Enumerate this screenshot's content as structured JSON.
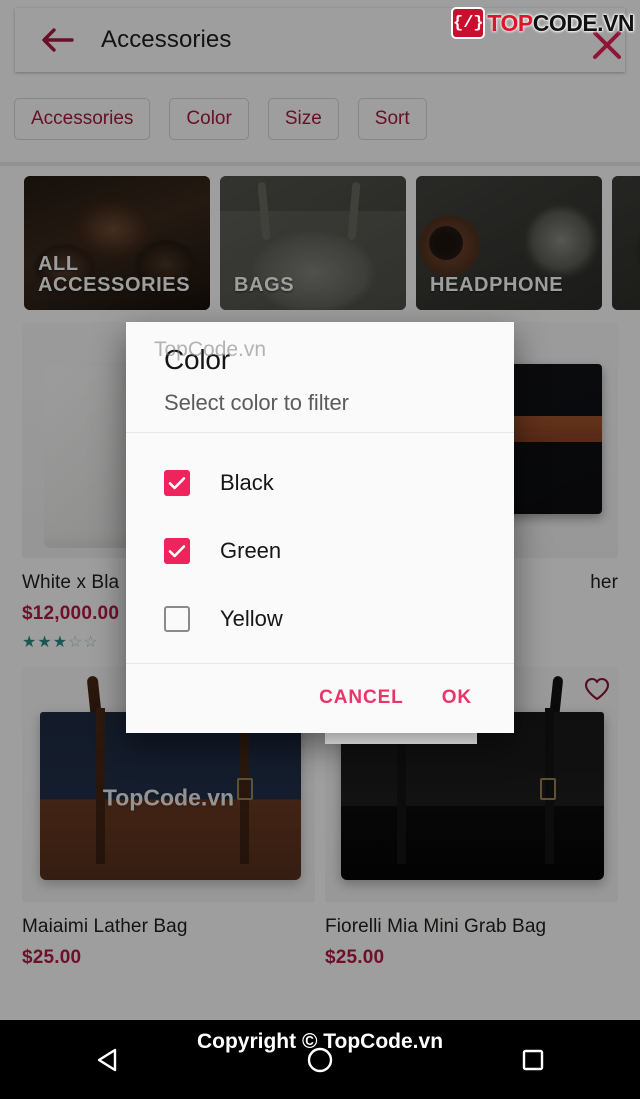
{
  "header": {
    "title": "Accessories",
    "back_icon": "back-arrow-icon",
    "close_icon": "close-x-icon"
  },
  "logo": {
    "badge": "{/}",
    "top": "TOP",
    "rest": "CODE.VN"
  },
  "filters": {
    "chips": [
      {
        "label": "Accessories"
      },
      {
        "label": "Color"
      },
      {
        "label": "Size"
      },
      {
        "label": "Sort"
      }
    ]
  },
  "categories": [
    {
      "label": "ALL\nACCESSORIES",
      "line1": "ALL",
      "line2": "ACCESSORIES"
    },
    {
      "label": "BAGS",
      "line1": "BAGS",
      "line2": ""
    },
    {
      "label": "HEADPHONE",
      "line1": "HEADPHONE",
      "line2": ""
    },
    {
      "label": "",
      "line1": "",
      "line2": ""
    }
  ],
  "products": {
    "row1": [
      {
        "name": "White x Bla",
        "price": "$12,000.00",
        "rating_filled": 3,
        "rating_total": 5,
        "stars_filled": "★★★",
        "stars_empty": "☆☆"
      },
      {
        "name": "her",
        "price": "",
        "rating_filled": 0,
        "rating_total": 5,
        "stars_filled": "",
        "stars_empty": ""
      }
    ],
    "row2": [
      {
        "name": "Maiaimi Lather Bag",
        "price": "$25.00",
        "watermark": "TopCode.vn",
        "favorite_icon": "heart-outline-icon"
      },
      {
        "name": "Fiorelli Mia Mini Grab Bag",
        "price": "$25.00",
        "watermark": "",
        "favorite_icon": "heart-outline-icon"
      }
    ]
  },
  "dialog": {
    "title": "Color",
    "subtitle": "Select color to filter",
    "watermark": "TopCode.vn",
    "options": [
      {
        "label": "Black",
        "checked": true
      },
      {
        "label": "Green",
        "checked": true
      },
      {
        "label": "Yellow",
        "checked": false
      }
    ],
    "cancel_label": "CANCEL",
    "ok_label": "OK"
  },
  "navbar": {
    "copyright": "Copyright © TopCode.vn",
    "back_icon": "nav-back-triangle-icon",
    "home_icon": "nav-home-circle-icon",
    "recents_icon": "nav-recents-square-icon"
  },
  "colors": {
    "accent_pink": "#f0245c",
    "accent_crimson": "#b41b46",
    "chip_text": "#a81a40",
    "star_teal": "#2e8f85",
    "logo_red": "#e0122e"
  }
}
